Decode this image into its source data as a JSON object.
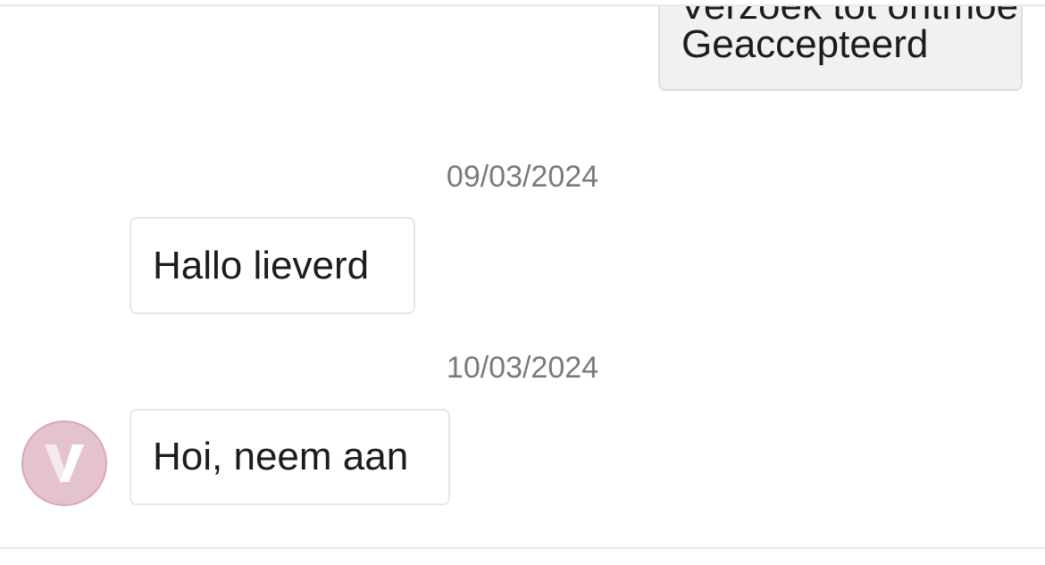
{
  "chat": {
    "previous_outgoing": {
      "clipped_line": "Verzoek tot ontmoeting",
      "text": "Geaccepteerd"
    },
    "groups": [
      {
        "date": "09/03/2024",
        "message": "Hallo lieverd"
      },
      {
        "date": "10/03/2024",
        "message": "Hoi, neem aan"
      }
    ],
    "avatar": {
      "letter": "V",
      "color": "#e5c3cc"
    }
  }
}
